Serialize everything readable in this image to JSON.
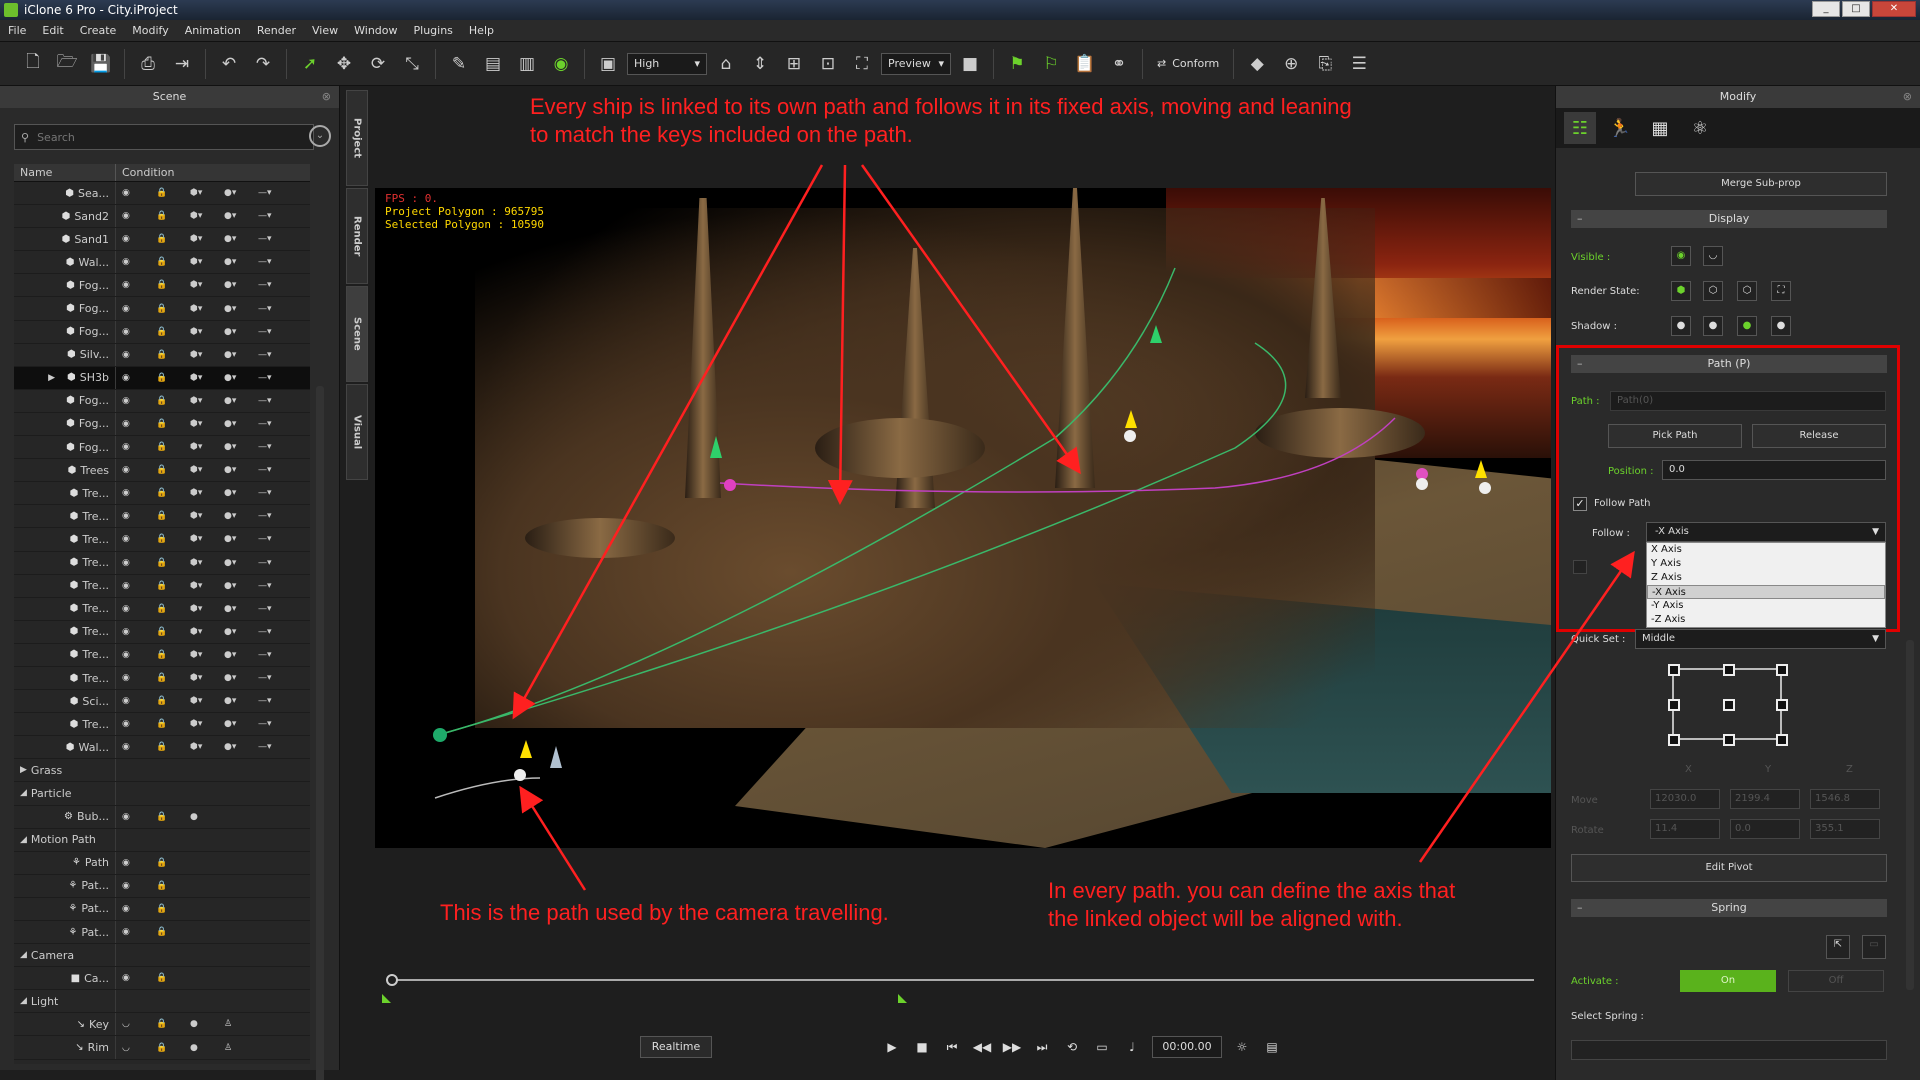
{
  "window": {
    "title": "iClone 6 Pro - City.iProject"
  },
  "menu": [
    "File",
    "Edit",
    "Create",
    "Modify",
    "Animation",
    "Render",
    "View",
    "Window",
    "Plugins",
    "Help"
  ],
  "toolbar": {
    "quality": "High",
    "preview": "Preview",
    "conform": "Conform"
  },
  "scene": {
    "title": "Scene",
    "search_placeholder": "Search",
    "col_name": "Name",
    "col_condition": "Condition",
    "rows": [
      {
        "name": "Sea...",
        "type": "prop"
      },
      {
        "name": "Sand2",
        "type": "prop"
      },
      {
        "name": "Sand1",
        "type": "prop"
      },
      {
        "name": "Wal...",
        "type": "prop"
      },
      {
        "name": "Fog...",
        "type": "prop"
      },
      {
        "name": "Fog...",
        "type": "prop"
      },
      {
        "name": "Fog...",
        "type": "prop"
      },
      {
        "name": "Silv...",
        "type": "prop"
      },
      {
        "name": "SH3b",
        "type": "prop",
        "selected": true
      },
      {
        "name": "Fog...",
        "type": "prop"
      },
      {
        "name": "Fog...",
        "type": "prop"
      },
      {
        "name": "Fog...",
        "type": "prop"
      },
      {
        "name": "Trees",
        "type": "prop"
      },
      {
        "name": "Tre...",
        "type": "prop"
      },
      {
        "name": "Tre...",
        "type": "prop"
      },
      {
        "name": "Tre...",
        "type": "prop"
      },
      {
        "name": "Tre...",
        "type": "prop"
      },
      {
        "name": "Tre...",
        "type": "prop"
      },
      {
        "name": "Tre...",
        "type": "prop"
      },
      {
        "name": "Tre...",
        "type": "prop"
      },
      {
        "name": "Tre...",
        "type": "prop"
      },
      {
        "name": "Tre...",
        "type": "prop"
      },
      {
        "name": "Sci...",
        "type": "prop"
      },
      {
        "name": "Tre...",
        "type": "prop"
      },
      {
        "name": "Wal...",
        "type": "prop"
      },
      {
        "name": "Grass",
        "type": "group",
        "expanded": false
      },
      {
        "name": "Particle",
        "type": "group",
        "expanded": true
      },
      {
        "name": "Bub...",
        "type": "particle"
      },
      {
        "name": "Motion Path",
        "type": "group",
        "expanded": true
      },
      {
        "name": "Path",
        "type": "path"
      },
      {
        "name": "Pat...",
        "type": "path"
      },
      {
        "name": "Pat...",
        "type": "path"
      },
      {
        "name": "Pat...",
        "type": "path"
      },
      {
        "name": "Camera",
        "type": "group",
        "expanded": true
      },
      {
        "name": "Ca...",
        "type": "camera"
      },
      {
        "name": "Light",
        "type": "group",
        "expanded": true
      },
      {
        "name": "Key",
        "type": "light"
      },
      {
        "name": "Rim",
        "type": "light"
      }
    ]
  },
  "side_tabs": [
    "Project",
    "Render",
    "Scene",
    "Visual"
  ],
  "viewport": {
    "fps": "FPS : 0.",
    "project_polygon": "Project Polygon : 965795",
    "selected_polygon": "Selected Polygon : 10590"
  },
  "timeline": {
    "realtime": "Realtime",
    "time": "00:00.00"
  },
  "modify": {
    "title": "Modify",
    "merge_subprop": "Merge Sub-prop",
    "display_section": "Display",
    "visible_label": "Visible :",
    "render_state_label": "Render State:",
    "shadow_label": "Shadow :",
    "path_section": "Path  (P)",
    "path_label": "Path :",
    "path_value": "Path(0)",
    "pick_path": "Pick Path",
    "release": "Release",
    "position_label": "Position :",
    "position_value": "0.0",
    "follow_path_label": "Follow Path",
    "follow_label": "Follow :",
    "follow_value": "-X Axis",
    "follow_options": [
      "X Axis",
      "Y Axis",
      "Z Axis",
      "-X Axis",
      "-Y Axis",
      "-Z Axis"
    ],
    "follow_selected_index": 3,
    "quick_set_label": "Quick Set :",
    "quick_set_value": "Middle",
    "axis_x": "X",
    "axis_y": "Y",
    "axis_z": "Z",
    "move_label": "Move",
    "move_values": [
      "12030.0",
      "2199.4",
      "1546.8"
    ],
    "rotate_label": "Rotate",
    "rotate_values": [
      "11.4",
      "0.0",
      "355.1"
    ],
    "edit_pivot": "Edit Pivot",
    "spring_section": "Spring",
    "activate_label": "Activate :",
    "on_label": "On",
    "off_label": "Off",
    "select_spring_label": "Select Spring :"
  },
  "annotations": {
    "top_line1": "Every ship is linked to its own path and follows it in its fixed axis, moving and leaning",
    "top_line2": "to match the keys included on the path.",
    "bottom_left": "This is the path used by the camera travelling.",
    "bottom_right_line1": "In every path. you can define  the axis that",
    "bottom_right_line2": "the linked object will be aligned with."
  },
  "colors": {
    "accent": "#6cd22c",
    "annotation": "#ff2020",
    "highlight_box": "#e00000"
  }
}
